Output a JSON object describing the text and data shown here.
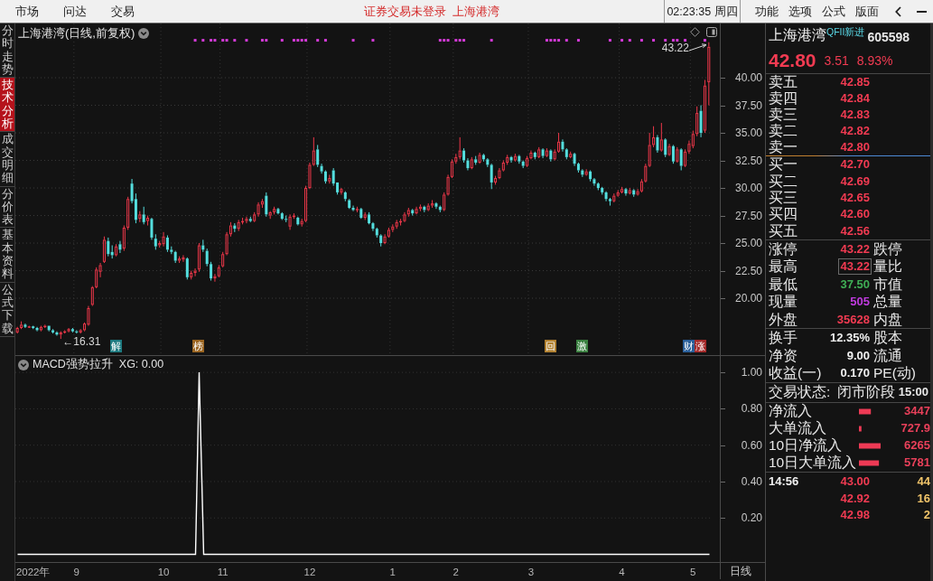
{
  "menu_bar": {
    "left_items": [
      "市场",
      "问达",
      "交易"
    ],
    "notices": [
      "证券交易未登录",
      "上海港湾"
    ],
    "clock": "02:23:35 周四",
    "right_items": [
      "功能",
      "选项",
      "公式",
      "版面"
    ]
  },
  "side_tabs": [
    {
      "label": "分时走势",
      "selected": false
    },
    {
      "label": "技术分析",
      "selected": true
    },
    {
      "label": "成交明细",
      "selected": false
    },
    {
      "label": "分价表",
      "selected": false
    },
    {
      "label": "基本资料",
      "selected": false
    },
    {
      "label": "公式下载",
      "selected": false
    }
  ],
  "chart_area": {
    "chart_data": [
      {
        "type": "candlestick",
        "title": "上海港湾(日线,前复权)",
        "ylim": [
          14.84,
          44.92
        ],
        "yticks": [
          {
            "value": 40,
            "label": "40.00"
          },
          {
            "value": 37.5,
            "label": "37.50"
          },
          {
            "value": 35,
            "label": "35.00"
          },
          {
            "value": 32.5,
            "label": "32.50"
          },
          {
            "value": 30,
            "label": "30.00"
          },
          {
            "value": 27.5,
            "label": "27.50"
          },
          {
            "value": 25,
            "label": "25.00"
          },
          {
            "value": 22.5,
            "label": "22.50"
          },
          {
            "value": 20,
            "label": "20.00"
          }
        ],
        "grid": true,
        "ohlc": [
          [
            16.9,
            17.4,
            16.8,
            17.3
          ],
          [
            17.3,
            17.9,
            17.2,
            17.6
          ],
          [
            17.6,
            17.7,
            17.3,
            17.4
          ],
          [
            17.4,
            17.5,
            17.3,
            17.45
          ],
          [
            17.45,
            17.5,
            17.2,
            17.3
          ],
          [
            17.3,
            17.4,
            17.0,
            17.1
          ],
          [
            17.1,
            17.5,
            17.0,
            17.4
          ],
          [
            17.4,
            17.6,
            17.3,
            17.5
          ],
          [
            17.5,
            17.5,
            17.0,
            17.1
          ],
          [
            17.1,
            17.2,
            16.8,
            16.9
          ],
          [
            16.9,
            17.0,
            16.6,
            16.7
          ],
          [
            16.7,
            17.0,
            16.31,
            16.9
          ],
          [
            16.9,
            17.1,
            16.8,
            17.0
          ],
          [
            17.0,
            17.3,
            16.9,
            17.2
          ],
          [
            17.2,
            17.3,
            16.9,
            17.0
          ],
          [
            17.0,
            17.1,
            16.8,
            16.9
          ],
          [
            16.9,
            17.2,
            16.8,
            17.1
          ],
          [
            17.1,
            17.8,
            17.0,
            17.7
          ],
          [
            17.6,
            19.3,
            17.5,
            19.1
          ],
          [
            19.4,
            21.1,
            19.3,
            21.0
          ],
          [
            21.0,
            22.8,
            20.9,
            22.6
          ],
          [
            22.4,
            23.2,
            21.9,
            23.0
          ],
          [
            23.3,
            25.6,
            23.2,
            25.3
          ],
          [
            25.2,
            25.5,
            23.8,
            24.0
          ],
          [
            24.2,
            24.8,
            23.6,
            23.9
          ],
          [
            23.9,
            24.9,
            23.8,
            24.7
          ],
          [
            24.9,
            25.2,
            24.1,
            24.4
          ],
          [
            24.5,
            26.6,
            24.3,
            26.4
          ],
          [
            26.4,
            29.2,
            26.2,
            29.0
          ],
          [
            30.4,
            30.82,
            28.6,
            28.8
          ],
          [
            29.0,
            29.5,
            26.8,
            27.1
          ],
          [
            27.2,
            27.9,
            26.9,
            27.6
          ],
          [
            27.6,
            28.3,
            26.7,
            26.9
          ],
          [
            27.0,
            27.5,
            26.6,
            27.3
          ],
          [
            27.2,
            27.3,
            25.3,
            25.5
          ],
          [
            25.4,
            25.8,
            24.4,
            24.7
          ],
          [
            24.8,
            25.2,
            24.6,
            25.0
          ],
          [
            24.9,
            26.0,
            24.7,
            25.6
          ],
          [
            25.5,
            25.7,
            24.2,
            24.4
          ],
          [
            24.4,
            24.7,
            24.0,
            24.2
          ],
          [
            24.2,
            24.3,
            23.2,
            23.4
          ],
          [
            23.4,
            23.8,
            23.2,
            23.6
          ],
          [
            23.5,
            23.9,
            23.3,
            23.7
          ],
          [
            23.6,
            23.7,
            21.7,
            21.9
          ],
          [
            21.9,
            22.5,
            21.7,
            22.3
          ],
          [
            22.3,
            22.7,
            22.0,
            22.5
          ],
          [
            22.6,
            25.0,
            22.4,
            24.8
          ],
          [
            24.8,
            25.3,
            24.2,
            24.4
          ],
          [
            24.3,
            24.5,
            22.9,
            23.1
          ],
          [
            23.1,
            23.3,
            21.6,
            21.8
          ],
          [
            21.8,
            22.2,
            21.5,
            22.0
          ],
          [
            22.0,
            23.0,
            21.9,
            22.8
          ],
          [
            22.9,
            24.2,
            22.8,
            24.0
          ],
          [
            24.0,
            26.0,
            23.9,
            25.8
          ],
          [
            25.8,
            26.9,
            25.6,
            26.6
          ],
          [
            26.6,
            26.8,
            26.0,
            26.3
          ],
          [
            26.3,
            27.1,
            26.1,
            26.9
          ],
          [
            26.9,
            27.3,
            26.7,
            27.0
          ],
          [
            27.0,
            27.4,
            26.8,
            27.2
          ],
          [
            27.2,
            27.4,
            26.9,
            27.0
          ],
          [
            27.0,
            27.8,
            26.9,
            27.6
          ],
          [
            27.6,
            28.7,
            27.4,
            28.5
          ],
          [
            28.5,
            29.0,
            28.2,
            28.8
          ],
          [
            29.3,
            29.6,
            27.4,
            27.6
          ],
          [
            27.5,
            27.9,
            27.2,
            27.8
          ],
          [
            27.8,
            28.3,
            27.6,
            28.1
          ],
          [
            28.1,
            28.2,
            27.6,
            27.7
          ],
          [
            27.7,
            27.8,
            27.1,
            27.2
          ],
          [
            27.2,
            27.5,
            26.9,
            27.1
          ],
          [
            26.5,
            27.6,
            26.2,
            27.4
          ],
          [
            27.4,
            27.7,
            27.2,
            27.5
          ],
          [
            27.3,
            27.4,
            26.6,
            26.7
          ],
          [
            26.7,
            27.2,
            26.5,
            27.0
          ],
          [
            27.0,
            30.2,
            26.9,
            30.0
          ],
          [
            30.0,
            32.3,
            29.9,
            32.1
          ],
          [
            32.1,
            34.6,
            32.0,
            33.4
          ],
          [
            33.5,
            33.9,
            31.9,
            32.1
          ],
          [
            32.0,
            32.2,
            31.3,
            31.5
          ],
          [
            31.5,
            31.6,
            30.4,
            30.6
          ],
          [
            30.6,
            31.2,
            30.4,
            30.9
          ],
          [
            31.6,
            31.8,
            30.2,
            30.4
          ],
          [
            30.5,
            30.5,
            29.4,
            29.6
          ],
          [
            29.6,
            30.0,
            29.4,
            29.9
          ],
          [
            29.6,
            29.7,
            28.8,
            29.0
          ],
          [
            28.9,
            29.0,
            28.1,
            28.2
          ],
          [
            28.2,
            28.4,
            27.9,
            28.0
          ],
          [
            28.0,
            28.3,
            27.8,
            28.1
          ],
          [
            28.1,
            28.2,
            27.2,
            27.3
          ],
          [
            27.3,
            27.8,
            27.1,
            27.6
          ],
          [
            27.6,
            27.8,
            26.7,
            26.8
          ],
          [
            26.8,
            26.9,
            26.1,
            26.3
          ],
          [
            26.3,
            26.4,
            25.5,
            25.7
          ],
          [
            25.7,
            25.8,
            24.7,
            25.0
          ],
          [
            25.0,
            25.8,
            24.9,
            25.6
          ],
          [
            25.6,
            26.4,
            25.5,
            26.2
          ],
          [
            26.2,
            26.7,
            26.0,
            26.5
          ],
          [
            26.5,
            27.1,
            26.3,
            26.9
          ],
          [
            26.9,
            27.2,
            26.6,
            27.0
          ],
          [
            27.0,
            27.8,
            26.9,
            27.6
          ],
          [
            27.6,
            28.2,
            27.4,
            28.0
          ],
          [
            28.0,
            28.1,
            27.5,
            27.7
          ],
          [
            27.7,
            28.3,
            27.6,
            28.1
          ],
          [
            28.1,
            28.5,
            27.9,
            28.3
          ],
          [
            28.3,
            28.4,
            27.8,
            28.0
          ],
          [
            28.0,
            28.6,
            27.9,
            28.4
          ],
          [
            28.4,
            28.9,
            28.2,
            28.6
          ],
          [
            28.6,
            28.7,
            28.1,
            28.3
          ],
          [
            28.3,
            28.4,
            27.8,
            28.0
          ],
          [
            28.0,
            29.6,
            27.9,
            29.4
          ],
          [
            29.4,
            31.2,
            29.3,
            31.0
          ],
          [
            31.0,
            32.6,
            30.9,
            32.4
          ],
          [
            32.4,
            33.1,
            32.2,
            32.8
          ],
          [
            32.8,
            34.6,
            32.6,
            33.4
          ],
          [
            33.4,
            33.6,
            32.3,
            32.5
          ],
          [
            32.5,
            32.7,
            31.6,
            31.8
          ],
          [
            31.8,
            32.8,
            31.7,
            32.6
          ],
          [
            32.6,
            32.9,
            32.1,
            32.3
          ],
          [
            32.3,
            33.2,
            32.2,
            33.0
          ],
          [
            33.0,
            33.1,
            32.4,
            32.6
          ],
          [
            32.6,
            32.7,
            31.9,
            32.1
          ],
          [
            32.1,
            32.2,
            29.9,
            30.5
          ],
          [
            30.5,
            31.1,
            30.3,
            30.9
          ],
          [
            30.9,
            31.8,
            30.8,
            31.6
          ],
          [
            31.6,
            32.5,
            31.5,
            32.3
          ],
          [
            32.3,
            33.0,
            32.1,
            32.8
          ],
          [
            32.8,
            32.9,
            32.3,
            32.5
          ],
          [
            32.5,
            33.1,
            32.4,
            32.9
          ],
          [
            32.9,
            33.0,
            32.2,
            32.4
          ],
          [
            32.4,
            32.5,
            31.8,
            32.0
          ],
          [
            32.0,
            32.9,
            31.9,
            32.7
          ],
          [
            32.7,
            33.4,
            32.6,
            33.2
          ],
          [
            33.2,
            33.3,
            32.6,
            32.8
          ],
          [
            32.8,
            33.7,
            32.7,
            33.5
          ],
          [
            33.5,
            33.6,
            32.7,
            32.9
          ],
          [
            32.9,
            33.6,
            32.8,
            33.4
          ],
          [
            33.4,
            33.5,
            32.4,
            32.6
          ],
          [
            32.6,
            33.5,
            32.5,
            33.3
          ],
          [
            33.3,
            35.0,
            33.2,
            34.2
          ],
          [
            34.2,
            34.4,
            33.3,
            33.5
          ],
          [
            33.5,
            33.6,
            32.6,
            32.8
          ],
          [
            32.8,
            33.3,
            32.7,
            33.1
          ],
          [
            33.1,
            33.2,
            32.0,
            32.2
          ],
          [
            32.2,
            32.3,
            31.4,
            31.6
          ],
          [
            31.6,
            31.7,
            31.0,
            31.2
          ],
          [
            31.2,
            31.7,
            31.1,
            31.5
          ],
          [
            31.5,
            31.6,
            30.6,
            30.8
          ],
          [
            30.8,
            30.9,
            30.2,
            30.4
          ],
          [
            30.4,
            30.5,
            29.8,
            30.0
          ],
          [
            30.0,
            30.1,
            29.4,
            29.6
          ],
          [
            29.6,
            29.7,
            28.8,
            29.0
          ],
          [
            29.0,
            29.1,
            28.4,
            28.8
          ],
          [
            28.8,
            29.5,
            28.7,
            29.3
          ],
          [
            29.3,
            29.8,
            29.2,
            29.6
          ],
          [
            29.6,
            30.1,
            29.5,
            29.9
          ],
          [
            29.9,
            30.0,
            29.3,
            29.5
          ],
          [
            29.5,
            30.0,
            29.4,
            29.8
          ],
          [
            29.8,
            29.9,
            29.2,
            29.4
          ],
          [
            29.4,
            29.9,
            29.3,
            29.7
          ],
          [
            29.7,
            30.8,
            29.6,
            30.6
          ],
          [
            30.6,
            32.2,
            30.5,
            32.0
          ],
          [
            32.0,
            35.0,
            31.9,
            33.9
          ],
          [
            33.9,
            35.6,
            33.7,
            34.6
          ],
          [
            34.6,
            34.8,
            33.2,
            33.4
          ],
          [
            33.4,
            35.9,
            33.3,
            34.4
          ],
          [
            34.4,
            34.5,
            32.8,
            33.0
          ],
          [
            33.0,
            34.0,
            32.9,
            33.8
          ],
          [
            33.8,
            33.9,
            32.2,
            32.4
          ],
          [
            32.4,
            33.7,
            32.3,
            33.5
          ],
          [
            33.5,
            33.6,
            31.6,
            32.0
          ],
          [
            32.0,
            33.5,
            31.9,
            33.3
          ],
          [
            33.3,
            34.3,
            33.1,
            34.0
          ],
          [
            33.8,
            35.2,
            33.6,
            34.9
          ],
          [
            34.9,
            37.4,
            34.7,
            36.8
          ],
          [
            37.0,
            37.5,
            34.6,
            35.0
          ],
          [
            35.2,
            39.8,
            35.0,
            39.29
          ],
          [
            39.6,
            43.22,
            37.5,
            42.8
          ]
        ],
        "series": [
          {
            "type": "scatter",
            "color": "#d23ad6",
            "values": [
              null,
              null,
              null,
              null,
              null,
              null,
              null,
              null,
              null,
              null,
              null,
              null,
              null,
              null,
              null,
              null,
              null,
              null,
              null,
              null,
              null,
              null,
              null,
              null,
              null,
              null,
              null,
              null,
              null,
              null,
              null,
              null,
              null,
              null,
              null,
              null,
              null,
              null,
              null,
              null,
              null,
              null,
              null,
              null,
              null,
              43.4,
              null,
              43.4,
              null,
              43.4,
              43.4,
              null,
              43.4,
              43.4,
              null,
              43.4,
              null,
              null,
              43.4,
              null,
              null,
              null,
              43.4,
              43.4,
              null,
              null,
              null,
              43.4,
              null,
              null,
              43.4,
              43.4,
              43.4,
              43.4,
              null,
              null,
              43.4,
              null,
              43.4,
              null,
              null,
              null,
              null,
              null,
              null,
              43.4,
              null,
              null,
              null,
              null,
              43.4,
              null,
              null,
              null,
              null,
              null,
              null,
              null,
              null,
              null,
              null,
              null,
              null,
              null,
              null,
              null,
              null,
              43.4,
              43.4,
              43.4,
              null,
              43.4,
              43.4,
              43.4,
              null,
              null,
              null,
              null,
              null,
              null,
              43.4,
              null,
              null,
              null,
              null,
              null,
              null,
              null,
              null,
              null,
              null,
              null,
              null,
              null,
              43.4,
              43.4,
              43.4,
              43.4,
              null,
              43.4,
              null,
              null,
              43.4,
              null,
              null,
              null,
              null,
              null,
              null,
              null,
              43.4,
              null,
              null,
              43.4,
              null,
              43.4,
              null,
              null,
              43.4,
              null,
              null,
              43.4,
              null,
              null,
              43.4,
              null,
              43.4,
              43.4,
              null,
              43.4,
              null,
              null,
              null,
              null,
              43.4,
              null
            ]
          }
        ],
        "annotations": [
          "←16.31",
          "43.22"
        ]
      },
      {
        "type": "line",
        "title": "MACD强势拉升",
        "subtitle": "XG: 0.00",
        "color": "#ffffff",
        "ylim": [
          -0.0422,
          1.09
        ],
        "yticks": [
          {
            "value": 1,
            "label": "1.00"
          },
          {
            "value": 0.8,
            "label": "0.80"
          },
          {
            "value": 0.6,
            "label": "0.60"
          },
          {
            "value": 0.4,
            "label": "0.40"
          },
          {
            "value": 0.2,
            "label": "0.20"
          }
        ],
        "grid": true,
        "categories": [
          null,
          null,
          null,
          null,
          "2022年",
          null,
          null,
          null,
          null,
          null,
          null,
          null,
          null,
          null,
          null,
          "9",
          null,
          null,
          null,
          null,
          null,
          null,
          null,
          null,
          null,
          null,
          null,
          null,
          null,
          null,
          null,
          null,
          null,
          null,
          null,
          null,
          null,
          "10",
          null,
          null,
          null,
          null,
          null,
          null,
          null,
          null,
          null,
          null,
          null,
          null,
          null,
          null,
          "11",
          null,
          null,
          null,
          null,
          null,
          null,
          null,
          null,
          null,
          null,
          null,
          null,
          null,
          null,
          null,
          null,
          null,
          null,
          null,
          null,
          null,
          "12",
          null,
          null,
          null,
          null,
          null,
          null,
          null,
          null,
          null,
          null,
          null,
          null,
          null,
          null,
          null,
          null,
          null,
          null,
          null,
          null,
          "1",
          null,
          null,
          null,
          null,
          null,
          null,
          null,
          null,
          null,
          null,
          null,
          null,
          null,
          null,
          null,
          "2",
          null,
          null,
          null,
          null,
          null,
          null,
          null,
          null,
          null,
          null,
          null,
          null,
          null,
          null,
          null,
          null,
          null,
          null,
          "3",
          null,
          null,
          null,
          null,
          null,
          null,
          null,
          null,
          null,
          null,
          null,
          null,
          null,
          null,
          null,
          null,
          null,
          null,
          null,
          null,
          null,
          null,
          "4",
          null,
          null,
          null,
          null,
          null,
          null,
          null,
          null,
          null,
          null,
          null,
          null,
          null,
          null,
          null,
          null,
          null,
          "5",
          null,
          null,
          null,
          null
        ],
        "values": [
          0,
          0,
          0,
          0,
          0,
          0,
          0,
          0,
          0,
          0,
          0,
          0,
          0,
          0,
          0,
          0,
          0,
          0,
          0,
          0,
          0,
          0,
          0,
          0,
          0,
          0,
          0,
          0,
          0,
          0,
          0,
          0,
          0,
          0,
          0,
          0,
          0,
          0,
          0,
          0,
          0,
          0,
          0,
          0,
          0,
          0,
          1,
          0,
          0,
          0,
          0,
          0,
          0,
          0,
          0,
          0,
          0,
          0,
          0,
          0,
          0,
          0,
          0,
          0,
          0,
          0,
          0,
          0,
          0,
          0,
          0,
          0,
          0,
          0,
          0,
          0,
          0,
          0,
          0,
          0,
          0,
          0,
          0,
          0,
          0,
          0,
          0,
          0,
          0,
          0,
          0,
          0,
          0,
          0,
          0,
          0,
          0,
          0,
          0,
          0,
          0,
          0,
          0,
          0,
          0,
          0,
          0,
          0,
          0,
          0,
          0,
          0,
          0,
          0,
          0,
          0,
          0,
          0,
          0,
          0,
          0,
          0,
          0,
          0,
          0,
          0,
          0,
          0,
          0,
          0,
          0,
          0,
          0,
          0,
          0,
          0,
          0,
          0,
          0,
          0,
          0,
          0,
          0,
          0,
          0,
          0,
          0,
          0,
          0,
          0,
          0,
          0,
          0,
          0,
          0,
          0,
          0,
          0,
          0,
          0,
          0,
          0,
          0,
          0,
          0,
          0,
          0,
          0,
          0,
          0,
          0,
          0,
          0,
          0,
          0,
          0
        ]
      }
    ],
    "event_tags": [
      {
        "label": "解",
        "color": "#1d7a80"
      },
      {
        "label": "榜",
        "color": "#9a6420"
      },
      {
        "label": "回",
        "color": "#b08030"
      },
      {
        "label": "激",
        "color": "#3a8040"
      },
      {
        "label": "财",
        "color": "#2a5f9a"
      },
      {
        "label": "涨",
        "color": "#a52a2a"
      }
    ],
    "period_label": "日线"
  },
  "quote": {
    "name": "上海港湾",
    "tag": "QFII新进",
    "code": "605598",
    "price": "42.80",
    "change": "3.51",
    "change_pct": "8.93%",
    "asks": [
      {
        "label": "卖五",
        "price": "42.85"
      },
      {
        "label": "卖四",
        "price": "42.84"
      },
      {
        "label": "卖三",
        "price": "42.83"
      },
      {
        "label": "卖二",
        "price": "42.82"
      },
      {
        "label": "卖一",
        "price": "42.80"
      }
    ],
    "bids": [
      {
        "label": "买一",
        "price": "42.70"
      },
      {
        "label": "买二",
        "price": "42.69"
      },
      {
        "label": "买三",
        "price": "42.65"
      },
      {
        "label": "买四",
        "price": "42.60"
      },
      {
        "label": "买五",
        "price": "42.56"
      }
    ],
    "stats": [
      {
        "label": "涨停",
        "value": "43.22",
        "color": "#f23b52",
        "boxed": false,
        "label2": "跌停"
      },
      {
        "label": "最高",
        "value": "43.22",
        "color": "#f23b52",
        "boxed": true,
        "label2": "量比"
      },
      {
        "label": "最低",
        "value": "37.50",
        "color": "#3fae55",
        "boxed": false,
        "label2": "市值"
      },
      {
        "label": "现量",
        "value": "505",
        "color": "#c13be0",
        "boxed": false,
        "label2": "总量"
      },
      {
        "label": "外盘",
        "value": "35628",
        "color": "#f23b52",
        "boxed": false,
        "label2": "内盘"
      }
    ],
    "fundamentals": [
      {
        "label": "换手",
        "value": "12.35%",
        "label2": "股本"
      },
      {
        "label": "净资",
        "value": "9.00",
        "label2": "流通"
      },
      {
        "label": "收益(一)",
        "value": "0.170",
        "label2": "PE(动)"
      }
    ],
    "trade_status": {
      "label": "交易状态:",
      "phase": "闭市阶段",
      "time": "15:00"
    },
    "fund_flows": {
      "chart_data": [
        {
          "type": "bar",
          "orientation": "horizontal",
          "categories": [
            "净流入",
            "大单流入",
            "10日净流入",
            "10日大单流入"
          ],
          "values": [
            3447,
            727.9,
            6265,
            5781
          ],
          "xlim": [
            0,
            6265
          ],
          "data_labels": true,
          "color": "#ee3a55"
        }
      ]
    },
    "ticks": [
      {
        "time": "14:56",
        "price": "43.00",
        "volume": "44"
      },
      {
        "price": "42.92",
        "volume": "16"
      },
      {
        "price": "42.98",
        "volume": "2"
      }
    ]
  }
}
